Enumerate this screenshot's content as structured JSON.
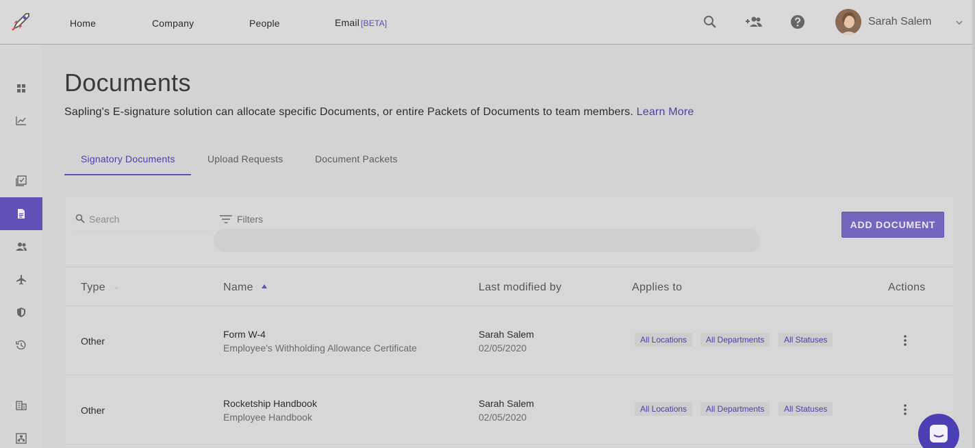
{
  "nav": {
    "links": [
      "Home",
      "Company",
      "People",
      "Email"
    ],
    "email_badge": "[BETA]",
    "user_name": "Sarah Salem"
  },
  "icons": {
    "logo": "rocket-logo-icon",
    "search": "search-icon",
    "add_people": "add-people-icon",
    "help": "help-icon",
    "caret": "chevron-down-icon",
    "sidebar": [
      "dashboard-icon",
      "chart-icon",
      "checklist-icon",
      "document-icon",
      "people-icon",
      "airplane-icon",
      "shield-icon",
      "history-icon",
      "building-icon",
      "org-chart-icon"
    ]
  },
  "page": {
    "title": "Documents",
    "subtitle": "Sapling's E-signature solution can allocate specific Documents, or entire Packets of Documents to team members.",
    "learn_more": "Learn More"
  },
  "tabs": [
    {
      "label": "Signatory Documents",
      "active": true
    },
    {
      "label": "Upload Requests",
      "active": false
    },
    {
      "label": "Document Packets",
      "active": false
    }
  ],
  "toolbar": {
    "search_placeholder": "Search",
    "filters_label": "Filters",
    "add_label": "ADD DOCUMENT"
  },
  "table": {
    "headers": [
      "Type",
      "Name",
      "Last modified by",
      "Applies to",
      "Actions"
    ],
    "rows": [
      {
        "type": "Other",
        "name": "Form W-4",
        "description": "Employee's Withholding Allowance Certificate",
        "modified_by": "Sarah Salem",
        "modified_date": "02/05/2020",
        "applies_to": [
          "All Locations",
          "All Departments",
          "All Statuses"
        ]
      },
      {
        "type": "Other",
        "name": "Rocketship Handbook",
        "description": "Employee Handbook",
        "modified_by": "Sarah Salem",
        "modified_date": "02/05/2020",
        "applies_to": [
          "All Locations",
          "All Departments",
          "All Statuses"
        ]
      }
    ]
  },
  "colors": {
    "accent": "#5f51b5",
    "link": "#4d3fa5"
  }
}
